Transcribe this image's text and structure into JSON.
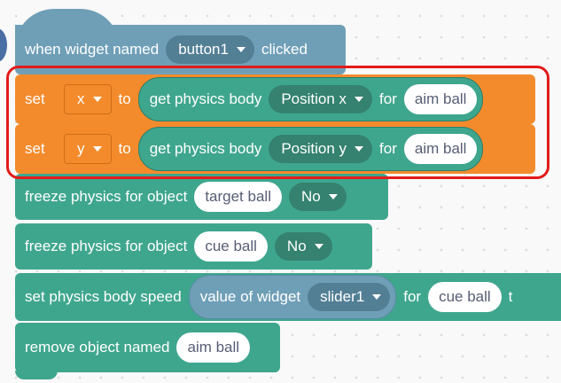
{
  "event_block": {
    "prefix": "when widget named",
    "widget": "button1",
    "suffix": "clicked"
  },
  "set_x": {
    "label": "set",
    "var": "x",
    "to": "to",
    "getter": "get physics body",
    "property": "Position x",
    "for": "for",
    "object": "aim ball"
  },
  "set_y": {
    "label": "set",
    "var": "y",
    "to": "to",
    "getter": "get physics body",
    "property": "Position y",
    "for": "for",
    "object": "aim ball"
  },
  "freeze1": {
    "label": "freeze physics for object",
    "object": "target ball",
    "value": "No"
  },
  "freeze2": {
    "label": "freeze physics for object",
    "object": "cue ball",
    "value": "No"
  },
  "speed": {
    "label": "set physics body speed",
    "reporter_label": "value of widget",
    "widget": "slider1",
    "for": "for",
    "object": "cue ball",
    "trail": "t"
  },
  "remove": {
    "label": "remove object named",
    "object": "aim ball"
  },
  "colors": {
    "event": "#6f9fb7",
    "variables": "#f38b2c",
    "physics": "#3fa68e",
    "highlight": "#e31b1b"
  }
}
